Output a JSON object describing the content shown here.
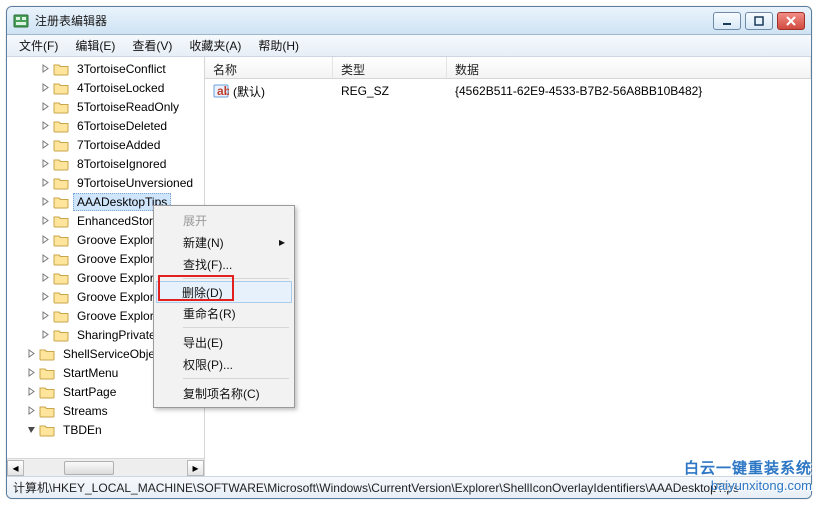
{
  "window": {
    "title": "注册表编辑器"
  },
  "menubar": [
    "文件(F)",
    "编辑(E)",
    "查看(V)",
    "收藏夹(A)",
    "帮助(H)"
  ],
  "tree": {
    "items": [
      {
        "depth": 2,
        "exp": "closed",
        "label": "3TortoiseConflict"
      },
      {
        "depth": 2,
        "exp": "closed",
        "label": "4TortoiseLocked"
      },
      {
        "depth": 2,
        "exp": "closed",
        "label": "5TortoiseReadOnly"
      },
      {
        "depth": 2,
        "exp": "closed",
        "label": "6TortoiseDeleted"
      },
      {
        "depth": 2,
        "exp": "closed",
        "label": "7TortoiseAdded"
      },
      {
        "depth": 2,
        "exp": "closed",
        "label": "8TortoiseIgnored"
      },
      {
        "depth": 2,
        "exp": "closed",
        "label": "9TortoiseUnversioned"
      },
      {
        "depth": 2,
        "exp": "closed",
        "label": "AAADesktopTips",
        "selected": true
      },
      {
        "depth": 2,
        "exp": "closed",
        "label": "EnhancedStor"
      },
      {
        "depth": 2,
        "exp": "closed",
        "label": "Groove Explor"
      },
      {
        "depth": 2,
        "exp": "closed",
        "label": "Groove Explor"
      },
      {
        "depth": 2,
        "exp": "closed",
        "label": "Groove Explor"
      },
      {
        "depth": 2,
        "exp": "closed",
        "label": "Groove Explor"
      },
      {
        "depth": 2,
        "exp": "closed",
        "label": "Groove Explor"
      },
      {
        "depth": 2,
        "exp": "closed",
        "label": "SharingPrivate"
      },
      {
        "depth": 1,
        "exp": "closed",
        "label": "ShellServiceObje"
      },
      {
        "depth": 1,
        "exp": "closed",
        "label": "StartMenu"
      },
      {
        "depth": 1,
        "exp": "closed",
        "label": "StartPage"
      },
      {
        "depth": 1,
        "exp": "closed",
        "label": "Streams"
      },
      {
        "depth": 1,
        "exp": "open",
        "label": "TBDEn"
      }
    ]
  },
  "list": {
    "headers": {
      "name": "名称",
      "type": "类型",
      "data": "数据"
    },
    "rows": [
      {
        "name": "(默认)",
        "type": "REG_SZ",
        "data": "{4562B511-62E9-4533-B7B2-56A8BB10B482}"
      }
    ]
  },
  "context_menu": {
    "items": [
      {
        "label": "展开",
        "disabled": true
      },
      {
        "label": "新建(N)",
        "submenu": true
      },
      {
        "label": "查找(F)..."
      },
      {
        "sep": true
      },
      {
        "label": "删除(D)",
        "highlighted": true
      },
      {
        "label": "重命名(R)"
      },
      {
        "sep": true
      },
      {
        "label": "导出(E)"
      },
      {
        "label": "权限(P)..."
      },
      {
        "sep": true
      },
      {
        "label": "复制项名称(C)"
      }
    ]
  },
  "statusbar": "计算机\\HKEY_LOCAL_MACHINE\\SOFTWARE\\Microsoft\\Windows\\CurrentVersion\\Explorer\\ShellIconOverlayIdentifiers\\AAADesktopTips",
  "watermark": {
    "l1": "白云一键重装系统",
    "l2": "baiyunxitong.com"
  }
}
